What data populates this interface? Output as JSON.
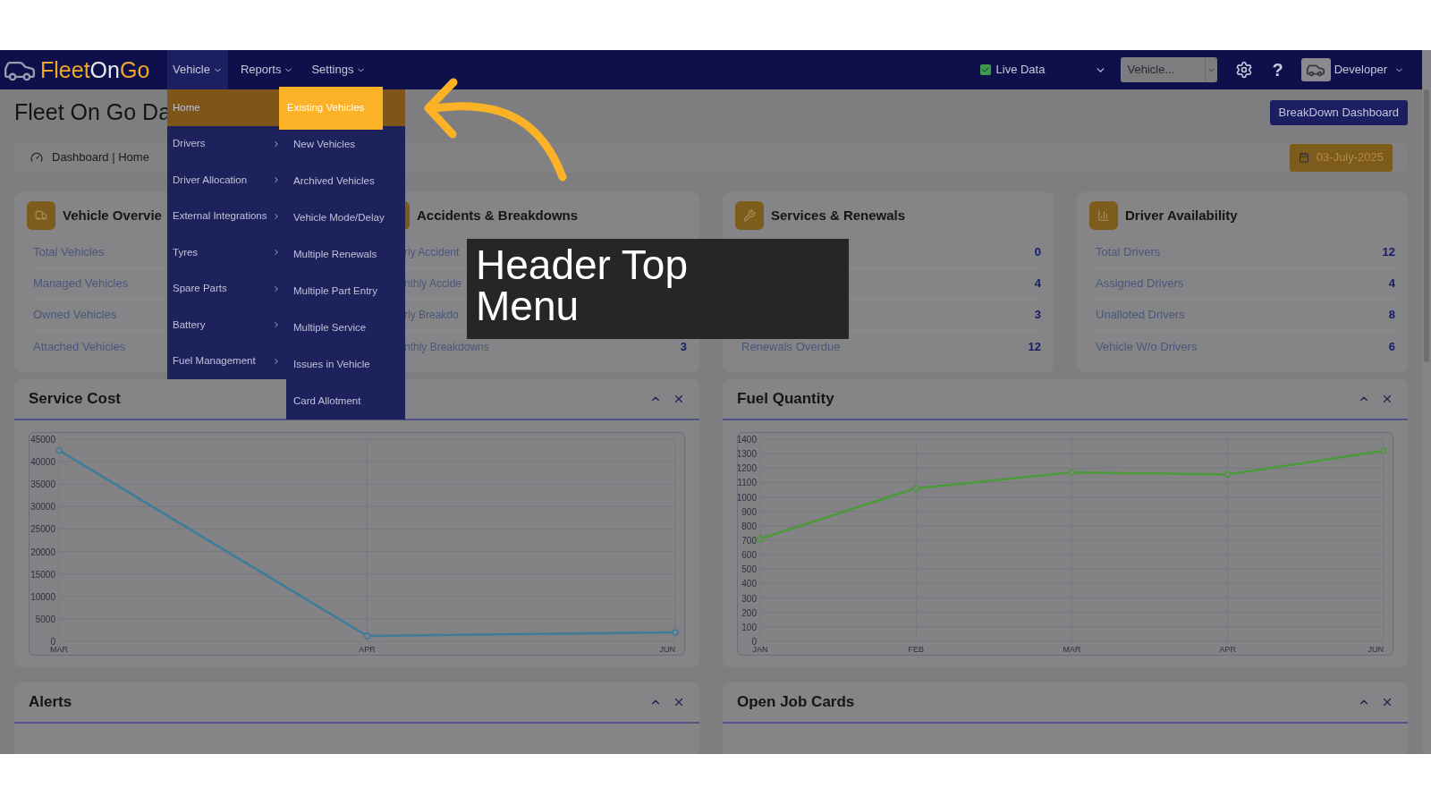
{
  "header": {
    "logo": [
      "Fleet",
      "On",
      "Go"
    ],
    "nav": [
      {
        "label": "Vehicle",
        "selected": true
      },
      {
        "label": "Reports",
        "selected": false
      },
      {
        "label": "Settings",
        "selected": false
      }
    ],
    "live_data": {
      "label": "Live Data",
      "checked": true
    },
    "vehicle_select": {
      "value": "Vehicle..."
    },
    "help": "?",
    "user": "Developer"
  },
  "vehicle_menu": [
    {
      "label": "Home",
      "selected": true,
      "has_submenu": false
    },
    {
      "label": "Drivers",
      "selected": false,
      "has_submenu": true
    },
    {
      "label": "Driver Allocation",
      "selected": false,
      "has_submenu": true
    },
    {
      "label": "External Integrations",
      "selected": false,
      "has_submenu": true
    },
    {
      "label": "Tyres",
      "selected": false,
      "has_submenu": true
    },
    {
      "label": "Spare Parts",
      "selected": false,
      "has_submenu": true
    },
    {
      "label": "Battery",
      "selected": false,
      "has_submenu": true
    },
    {
      "label": "Fuel Management",
      "selected": false,
      "has_submenu": true
    }
  ],
  "submenu": [
    {
      "label": "Existing Vehicles",
      "selected": true
    },
    {
      "label": "New Vehicles",
      "selected": false
    },
    {
      "label": "Archived Vehicles",
      "selected": false
    },
    {
      "label": "Vehicle Mode/Delay",
      "selected": false
    },
    {
      "label": "Multiple Renewals",
      "selected": false
    },
    {
      "label": "Multiple Part Entry",
      "selected": false
    },
    {
      "label": "Multiple Service",
      "selected": false
    },
    {
      "label": "Issues in Vehicle",
      "selected": false
    },
    {
      "label": "Card Allotment",
      "selected": false
    }
  ],
  "page_title": "Fleet On Go Da",
  "breakdown_button": "BreakDown Dashboard",
  "breadcrumb": "Dashboard | Home",
  "date": "03-July-2025",
  "cards": [
    {
      "kind": "vehicles",
      "title": "Vehicle Overvie",
      "rows": [
        {
          "label": "Total Vehicles"
        },
        {
          "label": "Managed Vehicles"
        },
        {
          "label": "Owned Vehicles"
        },
        {
          "label": "Attached Vehicles"
        }
      ]
    },
    {
      "kind": "accidents",
      "title": "Accidents & Breakdowns",
      "rows": [
        {
          "label": "rly Accident"
        },
        {
          "label": "nthly Accide"
        },
        {
          "label": "rly Breakdo"
        },
        {
          "label": "nthly Breakdowns",
          "value": "3"
        }
      ]
    },
    {
      "kind": "services",
      "title": "Services & Renewals",
      "rows": [
        {
          "value": "0"
        },
        {
          "value": "4"
        },
        {
          "value": "3"
        },
        {
          "label": "Renewals Overdue",
          "value": "12"
        }
      ]
    },
    {
      "kind": "drivers",
      "title": "Driver Availability",
      "rows": [
        {
          "label": "Total Drivers",
          "value": "12"
        },
        {
          "label": "Assigned Drivers",
          "value": "4"
        },
        {
          "label": "Unalloted Drivers",
          "value": "8"
        },
        {
          "label": "Vehicle W/o Drivers",
          "value": "6"
        }
      ]
    }
  ],
  "charts": [
    {
      "title": "Service Cost",
      "chart_data": {
        "type": "line",
        "grid": true,
        "categories": [
          "MAR",
          "APR",
          "JUN"
        ],
        "ylim": [
          0,
          45000
        ],
        "yticks": [
          0,
          5000,
          10000,
          15000,
          20000,
          25000,
          30000,
          35000,
          40000,
          45000
        ],
        "series": [
          {
            "color": "#3e7c9c",
            "marker": true,
            "values": [
              42500,
              1200,
              2000
            ]
          }
        ]
      }
    },
    {
      "title": "Fuel Quantity",
      "chart_data": {
        "type": "line",
        "grid": true,
        "categories": [
          "JAN",
          "FEB",
          "MAR",
          "APR",
          "JUN"
        ],
        "ylim": [
          0,
          1400
        ],
        "yticks": [
          0,
          100,
          200,
          300,
          400,
          500,
          600,
          700,
          800,
          900,
          1000,
          1100,
          1200,
          1300,
          1400
        ],
        "series": [
          {
            "color": "#4b9a3a",
            "marker": true,
            "values": [
              710,
              1060,
              1170,
              1155,
              1320
            ]
          }
        ]
      }
    }
  ],
  "bottom_panels": [
    "Alerts",
    "Open Job Cards"
  ],
  "callout": "Header Top Menu"
}
